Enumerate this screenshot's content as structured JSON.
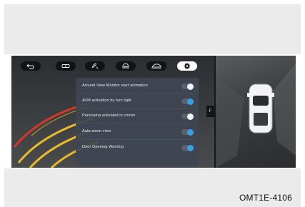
{
  "toolbar": {
    "buttons": [
      {
        "icon": "back-arrow-icon",
        "active": false
      },
      {
        "icon": "front-camera-icon",
        "active": false
      },
      {
        "icon": "side-view-icon",
        "active": false
      },
      {
        "icon": "car-front-icon",
        "active": false
      },
      {
        "icon": "car-side-icon",
        "active": false
      },
      {
        "icon": "gear-icon",
        "active": true
      }
    ]
  },
  "settings": {
    "items": [
      {
        "label": "Around View Monitor start animation",
        "enabled": false
      },
      {
        "label": "AVM activation by turn light",
        "enabled": true
      },
      {
        "label": "Panorama activated in corner",
        "enabled": false
      },
      {
        "label": "Auto zoom view",
        "enabled": true
      },
      {
        "label": "Door Opening Warning",
        "enabled": true
      }
    ]
  },
  "side_tab": {
    "label": "F"
  },
  "caption": "OMT1E-4106",
  "colors": {
    "toggle_on": "#3aa0e6",
    "guide_yellow": "#e8b92a",
    "guide_red": "#d5372d"
  }
}
